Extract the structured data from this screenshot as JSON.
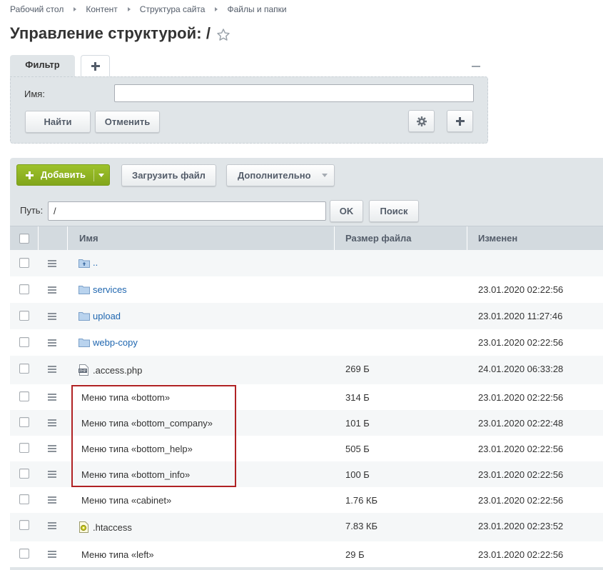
{
  "breadcrumb": [
    "Рабочий стол",
    "Контент",
    "Структура сайта",
    "Файлы и папки"
  ],
  "page_title": "Управление структурой: /",
  "filter": {
    "tab_label": "Фильтр",
    "name_label": "Имя:",
    "name_value": "",
    "find_label": "Найти",
    "cancel_label": "Отменить"
  },
  "toolbar": {
    "add_label": "Добавить",
    "upload_label": "Загрузить файл",
    "more_label": "Дополнительно"
  },
  "path": {
    "label": "Путь:",
    "value": "/",
    "ok_label": "OK",
    "search_label": "Поиск"
  },
  "table": {
    "headers": {
      "name": "Имя",
      "size": "Размер файла",
      "modified": "Изменен"
    },
    "rows": [
      {
        "name": "..",
        "size": "",
        "modified": "",
        "kind": "up-folder"
      },
      {
        "name": "services",
        "size": "",
        "modified": "23.01.2020 02:22:56",
        "kind": "folder"
      },
      {
        "name": "upload",
        "size": "",
        "modified": "23.01.2020 11:27:46",
        "kind": "folder"
      },
      {
        "name": "webp-copy",
        "size": "",
        "modified": "23.01.2020 02:22:56",
        "kind": "folder"
      },
      {
        "name": ".access.php",
        "size": "269 Б",
        "modified": "24.01.2020 06:33:28",
        "kind": "php-file"
      },
      {
        "name": "Меню типа «bottom»",
        "size": "314 Б",
        "modified": "23.01.2020 02:22:56",
        "kind": "menu"
      },
      {
        "name": "Меню типа «bottom_company»",
        "size": "101 Б",
        "modified": "23.01.2020 02:22:48",
        "kind": "menu"
      },
      {
        "name": "Меню типа «bottom_help»",
        "size": "505 Б",
        "modified": "23.01.2020 02:22:56",
        "kind": "menu"
      },
      {
        "name": "Меню типа «bottom_info»",
        "size": "100 Б",
        "modified": "23.01.2020 02:22:56",
        "kind": "menu"
      },
      {
        "name": "Меню типа «cabinet»",
        "size": "1.76 КБ",
        "modified": "23.01.2020 02:22:56",
        "kind": "menu"
      },
      {
        "name": ".htaccess",
        "size": "7.83 КБ",
        "modified": "23.01.2020 02:23:52",
        "kind": "htaccess-file"
      },
      {
        "name": "Меню типа «left»",
        "size": "29 Б",
        "modified": "23.01.2020 02:22:56",
        "kind": "menu"
      }
    ]
  },
  "colors": {
    "accent_green": "#8fb323",
    "link_blue": "#2067b0",
    "highlight_red": "#b02224"
  }
}
